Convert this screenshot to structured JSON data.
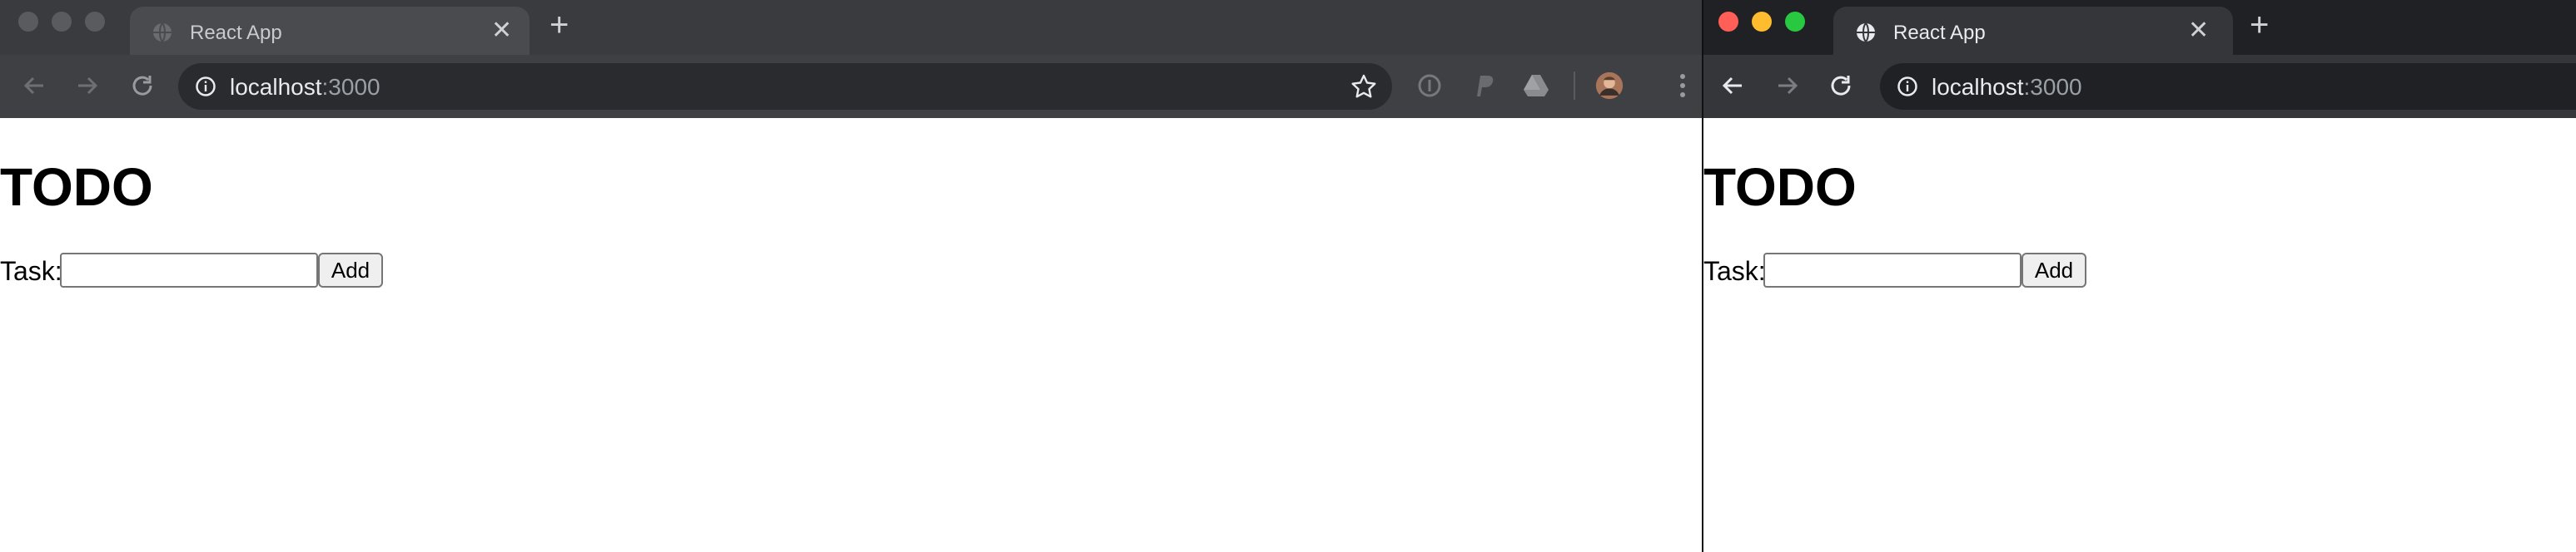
{
  "left_window": {
    "tab_title": "React App",
    "tab_close": "✕",
    "new_tab": "+",
    "url_host": "localhost",
    "url_port": ":3000",
    "extensions": [
      "info-circle-icon",
      "paypal-icon",
      "google-drive-icon",
      "profile-avatar"
    ],
    "page": {
      "heading": "TODO",
      "task_label": "Task:",
      "task_value": "",
      "add_label": "Add"
    }
  },
  "right_window": {
    "tab_title": "React App",
    "tab_close": "✕",
    "new_tab": "+",
    "url_host": "localhost",
    "url_port": ":3000",
    "page": {
      "heading": "TODO",
      "task_label": "Task:",
      "task_value": "",
      "add_label": "Add"
    }
  },
  "colors": {
    "traffic_close": "#ff5f57",
    "traffic_minimize": "#febc2e",
    "traffic_maximize": "#28c840",
    "active_tabstrip": "#202124",
    "active_toolbar": "#35363a",
    "inactive_tabstrip": "#3a3b3e"
  }
}
